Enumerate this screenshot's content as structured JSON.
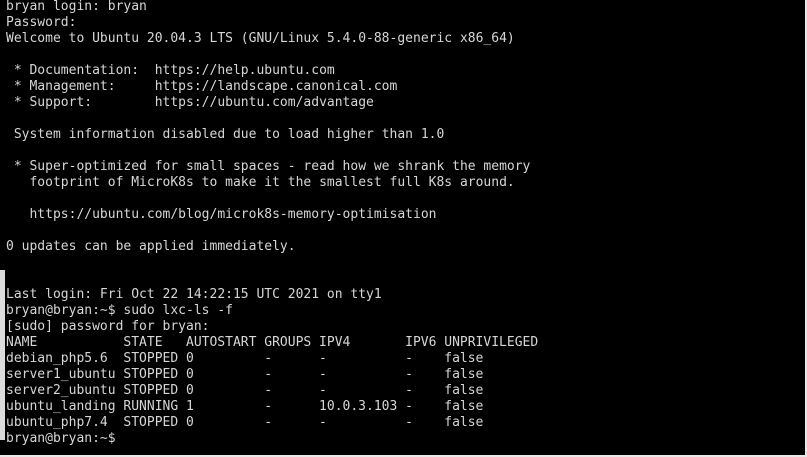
{
  "terminal": {
    "intro_lines": [
      "bryan login: bryan",
      "Password:",
      "Welcome to Ubuntu 20.04.3 LTS (GNU/Linux 5.4.0-88-generic x86_64)",
      "",
      " * Documentation:  https://help.ubuntu.com",
      " * Management:     https://landscape.canonical.com",
      " * Support:        https://ubuntu.com/advantage",
      "",
      " System information disabled due to load higher than 1.0",
      "",
      " * Super-optimized for small spaces - read how we shrank the memory",
      "   footprint of MicroK8s to make it the smallest full K8s around.",
      "",
      "   https://ubuntu.com/blog/microk8s-memory-optimisation",
      "",
      "0 updates can be applied immediately.",
      "",
      "",
      "Last login: Fri Oct 22 14:22:15 UTC 2021 on tty1",
      "bryan@bryan:~$ sudo lxc-ls -f",
      "[sudo] password for bryan:"
    ],
    "table": {
      "headers": [
        "NAME",
        "STATE",
        "AUTOSTART",
        "GROUPS",
        "IPV4",
        "IPV6",
        "UNPRIVILEGED"
      ],
      "rows": [
        [
          "debian_php5.6",
          "STOPPED",
          "0",
          "-",
          "-",
          "-",
          "false"
        ],
        [
          "server1_ubuntu",
          "STOPPED",
          "0",
          "-",
          "-",
          "-",
          "false"
        ],
        [
          "server2_ubuntu",
          "STOPPED",
          "0",
          "-",
          "-",
          "-",
          "false"
        ],
        [
          "ubuntu_landing",
          "RUNNING",
          "1",
          "-",
          "10.0.3.103",
          "-",
          "false"
        ],
        [
          "ubuntu_php7.4",
          "STOPPED",
          "0",
          "-",
          "-",
          "-",
          "false"
        ]
      ]
    },
    "prompt": "bryan@bryan:~$"
  }
}
